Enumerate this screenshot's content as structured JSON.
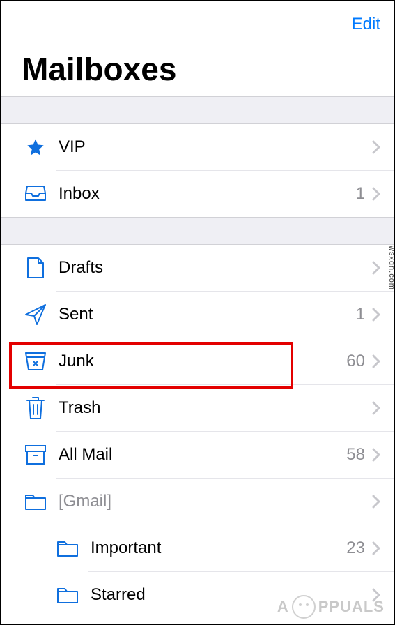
{
  "header": {
    "edit_label": "Edit",
    "title": "Mailboxes"
  },
  "section1": [
    {
      "name": "vip",
      "icon": "star-icon",
      "label": "VIP",
      "count": ""
    },
    {
      "name": "inbox",
      "icon": "inbox-icon",
      "label": "Inbox",
      "count": "1"
    }
  ],
  "section2": [
    {
      "name": "drafts",
      "icon": "drafts-icon",
      "label": "Drafts",
      "count": ""
    },
    {
      "name": "sent",
      "icon": "sent-icon",
      "label": "Sent",
      "count": "1"
    },
    {
      "name": "junk",
      "icon": "junk-icon",
      "label": "Junk",
      "count": "60"
    },
    {
      "name": "trash",
      "icon": "trash-icon",
      "label": "Trash",
      "count": ""
    },
    {
      "name": "allmail",
      "icon": "archive-icon",
      "label": "All Mail",
      "count": "58"
    },
    {
      "name": "gmail",
      "icon": "folder-icon",
      "label": "[Gmail]",
      "count": ""
    },
    {
      "name": "important",
      "icon": "folder-icon",
      "label": "Important",
      "count": "23"
    },
    {
      "name": "starred",
      "icon": "folder-icon",
      "label": "Starred",
      "count": ""
    }
  ],
  "watermark": "PPUALS",
  "side_text": "wsxdn.com"
}
